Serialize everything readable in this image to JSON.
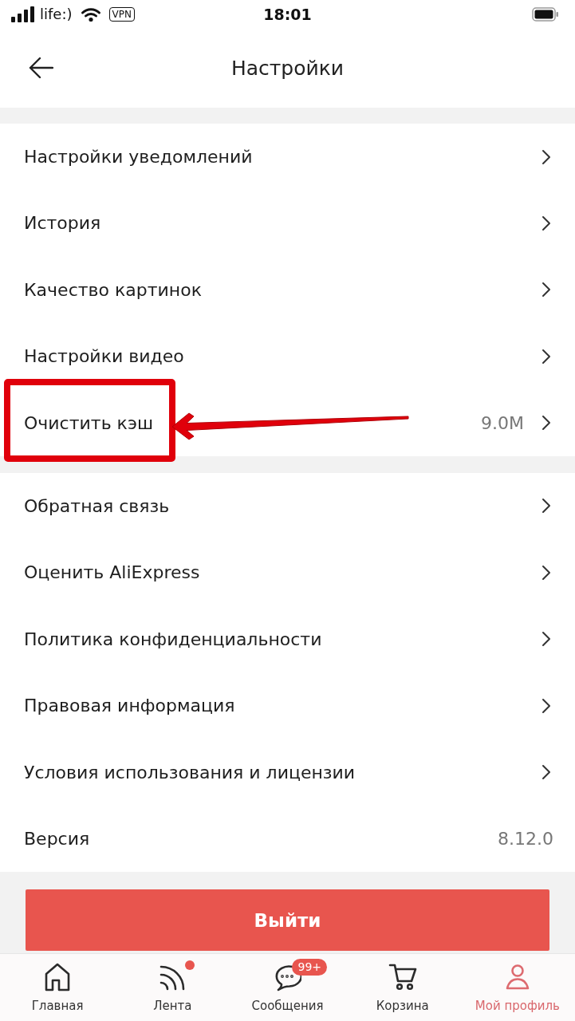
{
  "status_bar": {
    "carrier": "life:)",
    "vpn": "VPN",
    "time": "18:01"
  },
  "header": {
    "title": "Настройки"
  },
  "sections": [
    {
      "rows": [
        {
          "label": "Настройки уведомлений",
          "chevron": true,
          "highlighted": false
        },
        {
          "label": "История",
          "chevron": true,
          "highlighted": false
        },
        {
          "label": "Качество картинок",
          "chevron": true,
          "highlighted": false
        },
        {
          "label": "Настройки видео",
          "chevron": true,
          "highlighted": false
        },
        {
          "label": "Очистить кэш",
          "value": "9.0M",
          "chevron": true,
          "highlighted": true
        }
      ]
    },
    {
      "rows": [
        {
          "label": "Обратная связь",
          "chevron": true,
          "highlighted": false
        },
        {
          "label": "Оценить AliExpress",
          "chevron": true,
          "highlighted": false
        },
        {
          "label": "Политика конфиденциальности",
          "chevron": true,
          "highlighted": false
        },
        {
          "label": "Правовая информация",
          "chevron": true,
          "highlighted": false
        },
        {
          "label": "Условия использования и лицензии",
          "chevron": true,
          "highlighted": false
        },
        {
          "label": "Версия",
          "value": "8.12.0",
          "chevron": false,
          "highlighted": false
        }
      ]
    }
  ],
  "logout_button": {
    "label": "Выйти"
  },
  "tab_bar": {
    "tabs": [
      {
        "label": "Главная",
        "selected": false,
        "dot": false
      },
      {
        "label": "Лента",
        "selected": false,
        "dot": true
      },
      {
        "label": "Сообщения",
        "selected": false,
        "dot": false,
        "badge": "99+"
      },
      {
        "label": "Корзина",
        "selected": false,
        "dot": false
      },
      {
        "label": "Мой профиль",
        "selected": true,
        "dot": false
      }
    ]
  }
}
